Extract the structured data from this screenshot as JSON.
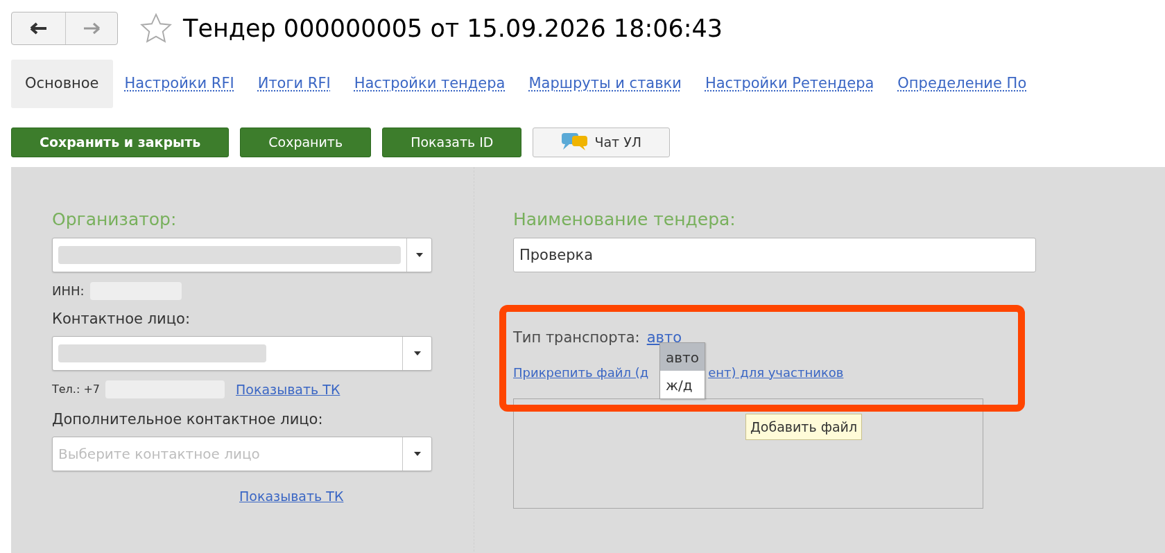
{
  "window": {
    "title": "Тендер 000000005 от 15.09.2026 18:06:43",
    "favorite": false
  },
  "tabs": [
    {
      "label": "Основное",
      "selected": true
    },
    {
      "label": "Настройки RFI",
      "selected": false
    },
    {
      "label": "Итоги RFI",
      "selected": false
    },
    {
      "label": "Настройки тендера",
      "selected": false
    },
    {
      "label": "Маршруты и ставки",
      "selected": false
    },
    {
      "label": "Настройки Ретендера",
      "selected": false
    },
    {
      "label": "Определение По",
      "selected": false
    }
  ],
  "toolbar": [
    {
      "label": "Сохранить и закрыть",
      "kind": "primary"
    },
    {
      "label": "Сохранить",
      "kind": "green"
    },
    {
      "label": "Показать ID",
      "kind": "green"
    },
    {
      "label": "Чат УЛ",
      "kind": "chat"
    }
  ],
  "organizer": {
    "label": "Организатор:",
    "inn_label": "ИНН:"
  },
  "contact": {
    "label": "Контактное лицо:",
    "phone_label": "Тел.: +7",
    "link": "Показывать ТК"
  },
  "extra_contact": {
    "label": "Дополнительное контактное лицо:",
    "placeholder": "Выберите контактное лицо",
    "link": "Показывать ТК"
  },
  "tender_name": {
    "label": "Наименование тендера:",
    "value": "Проверка"
  },
  "transport": {
    "label": "Тип транспорта:",
    "value": "авто",
    "options": [
      {
        "label": "авто",
        "selected": true
      },
      {
        "label": "ж/д",
        "selected": false
      }
    ]
  },
  "attach_link": [
    "Прикрепить файл (д",
    "ент) для участников"
  ],
  "tooltip": "Добавить файл"
}
